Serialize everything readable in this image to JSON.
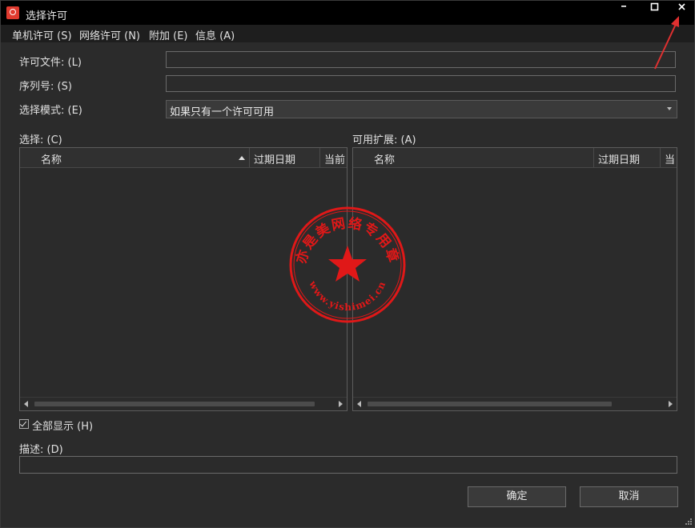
{
  "window": {
    "title": "选择许可"
  },
  "titlebar": {
    "minimize": "▬",
    "maximize": "□",
    "close": "✕"
  },
  "menu": [
    {
      "label": "单机许可 (S)"
    },
    {
      "label": "网络许可 (N)"
    },
    {
      "label": "附加 (E)"
    },
    {
      "label": "信息 (A)"
    }
  ],
  "form": {
    "license_file_label": "许可文件: (L)",
    "license_file_value": "",
    "serial_label": "序列号: (S)",
    "serial_value": "",
    "mode_label": "选择模式: (E)",
    "mode_value": "如果只有一个许可可用"
  },
  "left_list": {
    "title": "选择: (C)",
    "columns": [
      "名称",
      "过期日期",
      "当前"
    ]
  },
  "right_list": {
    "title": "可用扩展: (A)",
    "columns": [
      "名称",
      "过期日期",
      "当"
    ]
  },
  "show_all": {
    "label": "全部显示 (H)",
    "checked": true
  },
  "description": {
    "label": "描述: (D)",
    "value": ""
  },
  "buttons": {
    "ok": "确定",
    "cancel": "取消"
  },
  "watermark": {
    "top_text": "亦是美网络专用章",
    "bottom_text": "www.yishimei.cn",
    "color": "#e01818"
  },
  "colors": {
    "background": "#2b2b2b",
    "titlebar": "#000000",
    "menubar": "#1e1e1e",
    "annotation_arrow": "#e03030"
  },
  "icons": {
    "app": "license-app-icon",
    "sort": "sort-ascending-icon",
    "dropdown": "chevron-down-icon"
  }
}
